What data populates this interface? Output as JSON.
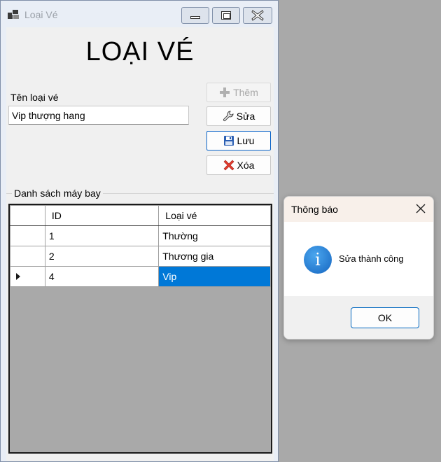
{
  "window": {
    "title": "Loại Vé",
    "heading": "LOẠI VÉ"
  },
  "form": {
    "label": "Tên loại vé",
    "value": "Vip thượng hang",
    "buttons": {
      "add": "Thêm",
      "edit": "Sửa",
      "save": "Lưu",
      "delete": "Xóa"
    }
  },
  "group": {
    "label": "Danh sách máy bay"
  },
  "grid": {
    "columns": [
      "ID",
      "Loại vé"
    ],
    "rows": [
      [
        "1",
        "Thường"
      ],
      [
        "2",
        "Thương gia"
      ],
      [
        "4",
        "Vip"
      ]
    ],
    "selected_row": 2,
    "selection_color": "#0078d7"
  },
  "dialog": {
    "title": "Thông báo",
    "message": "Sửa thành công",
    "ok": "OK",
    "icon": "info-icon"
  }
}
